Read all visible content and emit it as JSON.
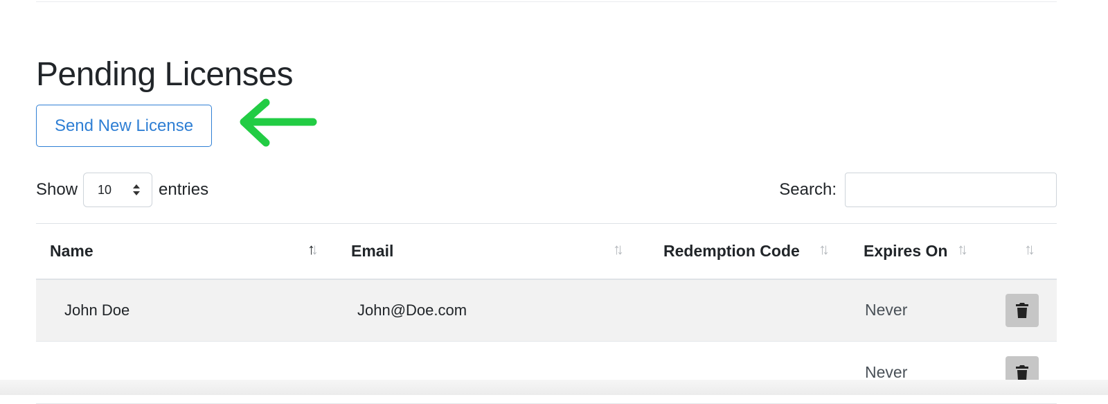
{
  "page": {
    "title": "Pending Licenses"
  },
  "actions": {
    "send_new_license": "Send New License"
  },
  "table_controls": {
    "show_label": "Show",
    "entries_label": "entries",
    "page_length": "10",
    "search_label": "Search:",
    "search_value": ""
  },
  "table": {
    "columns": [
      {
        "label": "Name",
        "sorted": "asc"
      },
      {
        "label": "Email",
        "sorted": "none"
      },
      {
        "label": "Redemption Code",
        "sorted": "none"
      },
      {
        "label": "Expires On",
        "sorted": "none"
      },
      {
        "label": "",
        "sorted": "none"
      }
    ],
    "rows": [
      {
        "name": "John Doe",
        "email": "John@Doe.com",
        "redemption_code": "",
        "expires_on": "Never",
        "action_icon": "trash-icon"
      },
      {
        "name": "",
        "email": "",
        "redemption_code": "",
        "expires_on": "Never",
        "action_icon": "trash-icon"
      }
    ]
  },
  "annotation": {
    "icon": "arrow-left-icon",
    "color": "#22cc44"
  },
  "colors": {
    "primary": "#2f7fd4",
    "text": "#212529",
    "row_stripe": "#f2f2f2",
    "delete_button": "#c6c6c6"
  }
}
